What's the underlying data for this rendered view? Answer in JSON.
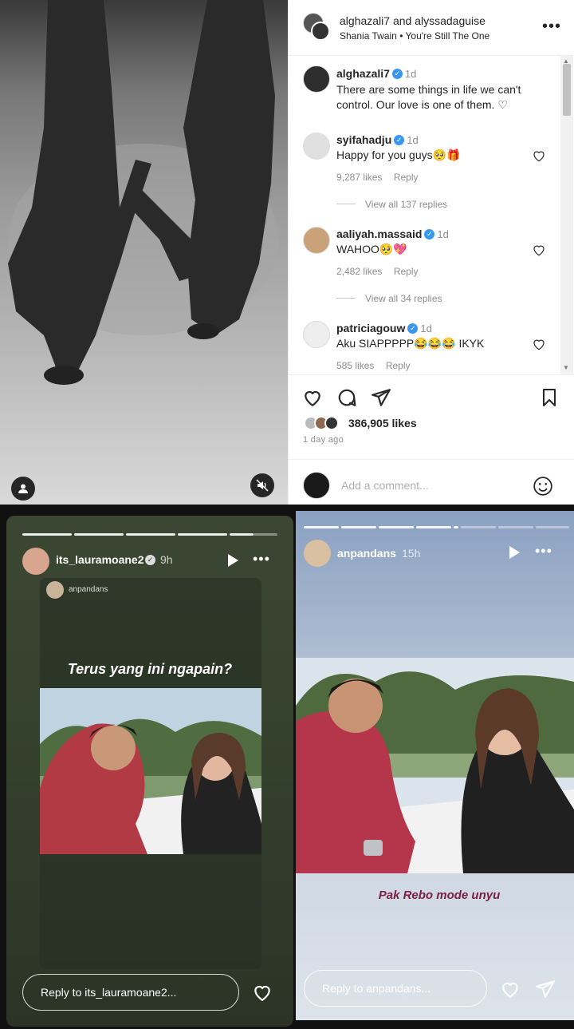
{
  "post": {
    "header": {
      "accounts": "alghazali7 and alyssadaguise",
      "music_artist": "Shania Twain",
      "music_title": "You're Still The One"
    },
    "caption": {
      "username": "alghazali7",
      "time": "1d",
      "text": "There are some things in life we can't control. Our love is one of them. ♡"
    },
    "comments": [
      {
        "username": "syifahadju",
        "time": "1d",
        "text": "Happy for you guys🥺🎁",
        "likes": "9,287 likes",
        "reply": "Reply",
        "view_replies": "View all 137 replies"
      },
      {
        "username": "aaliyah.massaid",
        "time": "1d",
        "text": "WAHOO🥺💖",
        "likes": "2,482 likes",
        "reply": "Reply",
        "view_replies": "View all 34 replies"
      },
      {
        "username": "patriciagouw",
        "time": "1d",
        "text": "Aku SIAPPPPP😂😂😂 IKYK",
        "likes": "585 likes",
        "reply": "Reply"
      }
    ],
    "likes": "386,905 likes",
    "age": "1 day ago",
    "comment_placeholder": "Add a comment..."
  },
  "story_left": {
    "username": "its_lauramoane2",
    "time": "9h",
    "shared_from": "anpandans",
    "caption": "Terus yang ini ngapain?",
    "reply_placeholder": "Reply to its_lauramoane2..."
  },
  "story_right": {
    "username": "anpandans",
    "time": "15h",
    "caption": "Pak Rebo mode unyu",
    "reply_placeholder": "Reply to anpandans..."
  },
  "colors": {
    "verified": "#3897f0",
    "story_left_bg": "#33402c",
    "caption_pink": "#7a2040"
  },
  "icons": [
    "heart-icon",
    "comment-icon",
    "share-icon",
    "bookmark-icon",
    "mute-icon",
    "user-tag-icon",
    "emoji-icon",
    "play-icon",
    "more-icon",
    "send-icon"
  ]
}
